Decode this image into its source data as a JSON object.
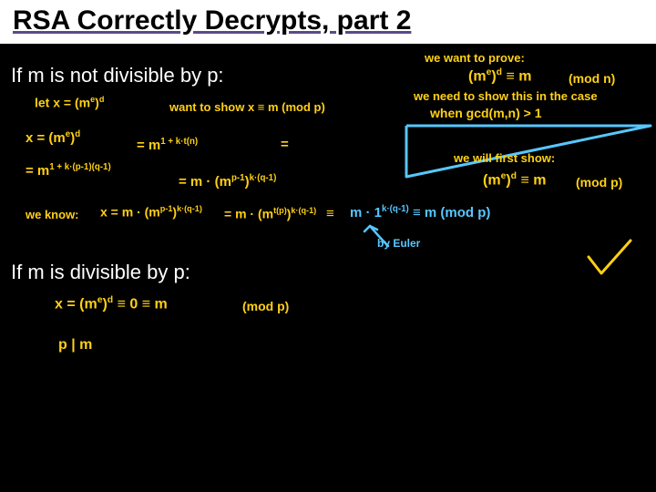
{
  "title": "RSA Correctly Decrypts, part 2",
  "section1": "If m is not divisible by p:",
  "section2": "If m is divisible by p:",
  "right": {
    "r1": "we want to prove:",
    "r2_lhs": "(m",
    "r2_e": "e",
    "r2_rparen_d": ")",
    "r2_d": "d",
    "r2_eqm": " ≡ m",
    "r2_modn": "(mod n)",
    "r3": "we need to show this in the case",
    "r4_a": "when gcd(m,n) > 1",
    "r5": "we will first show:",
    "r6_lhs": "(m",
    "r6_e": "e",
    "r6_rp": ")",
    "r6_d": "d",
    "r6_eq": " ≡ m",
    "r6_modp": "(mod p)"
  },
  "left": {
    "l1_let": "let   x = (m",
    "l1_e": "e",
    "l1_rp": ")",
    "l1_d": "d",
    "l1_want": "want to show   x ≡ m  (mod p)",
    "l2_a": "x = (m",
    "l2_e": "e",
    "l2_rp": ")",
    "l2_d": "d",
    "l2_eq1": "=   m",
    "l2_exp1": "1 + k·t(n)",
    "l2_eq2": "=",
    "l3_a": "= m",
    "l3_exp": "1 + k·(p-1)(q-1)",
    "l3_b": "=  m · (m",
    "l3_p1": "p-1",
    "l3_rp": ")",
    "l3_kq1": "k·(q-1)",
    "l4_know": "we know:",
    "l4_a": "x = m · (m",
    "l4_p1": "p-1",
    "l4_rp": ")",
    "l4_kq1": "k·(q-1)",
    "l4_b": "= m · (m",
    "l4_tp": "t(p)",
    "l4_rp2": ")",
    "l4_kq2": "k·(q-1)",
    "l4_eq": " ≡  ",
    "l4_m1": "m · 1",
    "l4_kq3": "k·(q-1)",
    "l4_res": " ≡ m (mod p)",
    "byeuler": "by Euler"
  },
  "case2": {
    "c1_a": "x = (m",
    "c1_e": "e",
    "c1_rp": ")",
    "c1_d": "d",
    "c1_eq": "  ≡  0  ≡ m",
    "c1_modp": "(mod p)",
    "c2": "p | m"
  }
}
